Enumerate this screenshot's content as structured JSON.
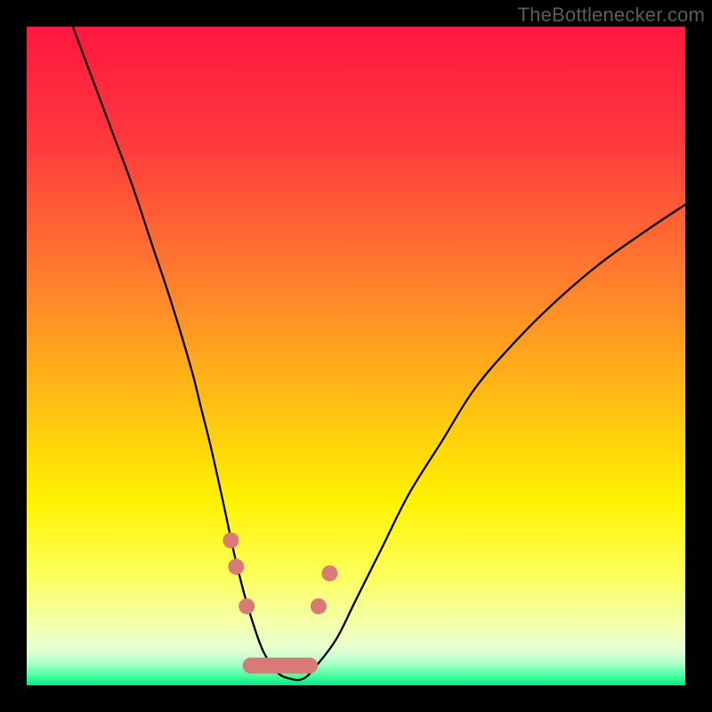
{
  "watermark": "TheBottlenecker.com",
  "colors": {
    "frame": "#000000",
    "gradient_stops": [
      {
        "pos": 0.0,
        "color": "#ff173f"
      },
      {
        "pos": 0.18,
        "color": "#ff3a3d"
      },
      {
        "pos": 0.38,
        "color": "#ff7d2d"
      },
      {
        "pos": 0.55,
        "color": "#ffb716"
      },
      {
        "pos": 0.72,
        "color": "#fff200"
      },
      {
        "pos": 0.83,
        "color": "#fcff58"
      },
      {
        "pos": 0.9,
        "color": "#f4ffa5"
      },
      {
        "pos": 0.945,
        "color": "#e6ffd0"
      },
      {
        "pos": 0.965,
        "color": "#b4ffce"
      },
      {
        "pos": 0.985,
        "color": "#4dffa0"
      },
      {
        "pos": 1.0,
        "color": "#00e884"
      }
    ],
    "curve": "#000000",
    "marker_fill": "#d77a78",
    "marker_stroke": "#c66"
  },
  "chart_data": {
    "type": "line",
    "title": "",
    "xlabel": "",
    "ylabel": "",
    "xlim": [
      0,
      100
    ],
    "ylim": [
      0,
      100
    ],
    "series": [
      {
        "name": "bottleneck-curve",
        "x": [
          7,
          10,
          13,
          16,
          19,
          22,
          25,
          26.5,
          28,
          30,
          31.5,
          33,
          34.5,
          36,
          38,
          40,
          42,
          44,
          47,
          50,
          54,
          58,
          63,
          68,
          74,
          80,
          87,
          94,
          100
        ],
        "y": [
          100,
          92,
          84,
          76,
          67,
          58,
          48,
          42,
          36,
          27,
          20,
          14,
          9,
          5,
          2,
          1,
          1,
          3,
          7,
          13,
          21,
          29,
          37,
          45,
          52,
          58,
          64,
          69,
          73
        ]
      }
    ],
    "markers": [
      {
        "x": 31.0,
        "y": 22.0
      },
      {
        "x": 31.8,
        "y": 18.0
      },
      {
        "x": 33.4,
        "y": 12.0
      },
      {
        "x": 44.3,
        "y": 12.0
      },
      {
        "x": 46.0,
        "y": 17.0
      }
    ],
    "bottom_band": {
      "x": [
        34.0,
        43.0
      ],
      "y": 3.0,
      "thickness_pct": 2.4
    }
  }
}
